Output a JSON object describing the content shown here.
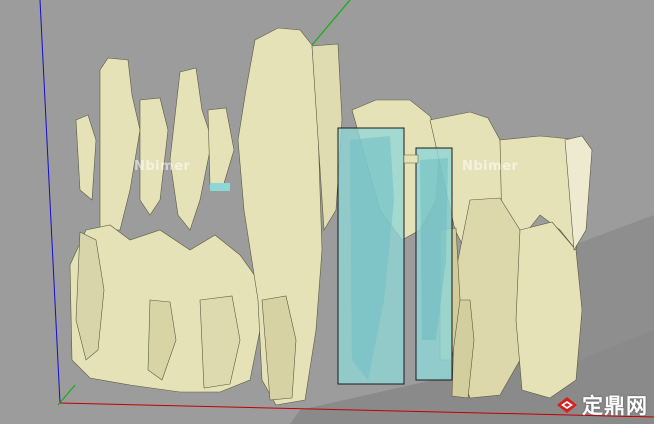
{
  "viewport": {
    "background": "#9c9c9c",
    "model_color": "#e6e2b8",
    "glass_color": "#8fd6d6",
    "axis_colors": {
      "red": "#c00000",
      "green": "#00b000",
      "blue": "#0000c8"
    }
  },
  "watermarks": [
    "Nbimer",
    "Nbimer"
  ],
  "logo": {
    "text": "定鼎网",
    "icon": "diamond-logo-icon",
    "accent": "#d91e1e"
  }
}
